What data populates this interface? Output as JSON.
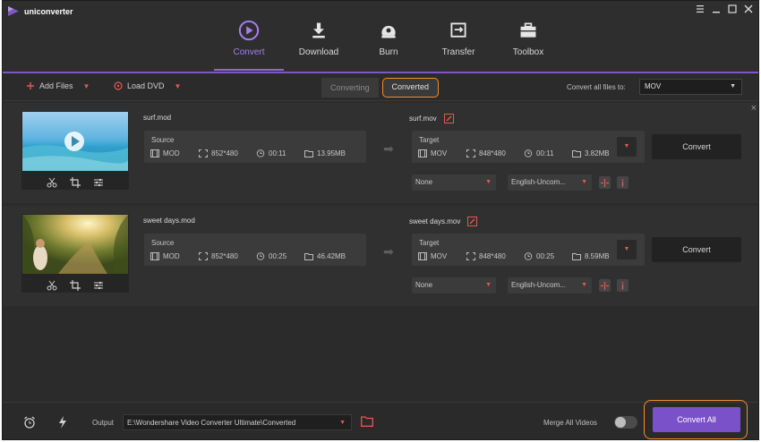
{
  "app": {
    "title": "uniconverter"
  },
  "nav": [
    {
      "label": "Convert",
      "icon": "convert-icon"
    },
    {
      "label": "Download",
      "icon": "download-icon"
    },
    {
      "label": "Burn",
      "icon": "burn-icon"
    },
    {
      "label": "Transfer",
      "icon": "transfer-icon"
    },
    {
      "label": "Toolbox",
      "icon": "toolbox-icon"
    }
  ],
  "toolbar": {
    "add_files": "Add Files",
    "load_dvd": "Load DVD",
    "tab_converting": "Converting",
    "tab_converted": "Converted",
    "convert_all_to_label": "Convert all files to:",
    "format_value": "MOV"
  },
  "items": [
    {
      "source_name": "surf.mod",
      "target_name": "surf.mov",
      "source": {
        "header": "Source",
        "format": "MOD",
        "resolution": "852*480",
        "duration": "00:11",
        "size": "13.95MB"
      },
      "target": {
        "header": "Target",
        "format": "MOV",
        "resolution": "848*480",
        "duration": "00:11",
        "size": "3.82MB"
      },
      "subtitle": "None",
      "audio": "English-Uncom...",
      "convert_label": "Convert"
    },
    {
      "source_name": "sweet days.mod",
      "target_name": "sweet days.mov",
      "source": {
        "header": "Source",
        "format": "MOD",
        "resolution": "852*480",
        "duration": "00:25",
        "size": "46.42MB"
      },
      "target": {
        "header": "Target",
        "format": "MOV",
        "resolution": "848*480",
        "duration": "00:25",
        "size": "8.59MB"
      },
      "subtitle": "None",
      "audio": "English-Uncom...",
      "convert_label": "Convert"
    }
  ],
  "footer": {
    "output_label": "Output",
    "output_path": "E:\\Wondershare Video Converter Ultimate\\Converted",
    "merge_label": "Merge All Videos",
    "merge_enabled": false,
    "convert_all": "Convert All"
  },
  "colors": {
    "accent": "#8e66e0",
    "convert_all_bg": "#7b51c9",
    "highlight": "#f28d2c",
    "caret": "#e05a4f"
  }
}
